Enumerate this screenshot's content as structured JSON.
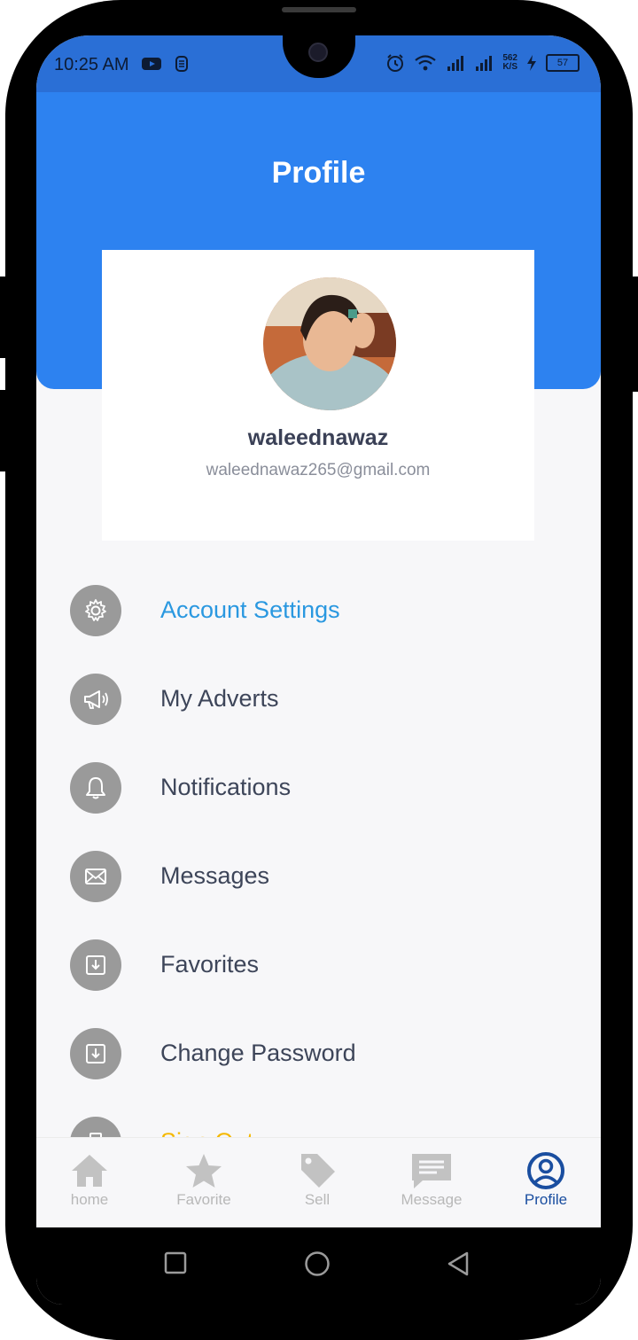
{
  "status_bar": {
    "time": "10:25 AM",
    "speed_top": "562",
    "speed_bottom": "K/S",
    "battery": "57",
    "icons": [
      "youtube-icon",
      "s-app-icon",
      "alarm-icon",
      "wifi-icon",
      "signal-icon",
      "signal-icon",
      "charging-icon",
      "battery-icon"
    ]
  },
  "header": {
    "title": "Profile"
  },
  "profile": {
    "name": "waleednawaz",
    "email": "waleednawaz265@gmail.com"
  },
  "menu": {
    "items": [
      {
        "label": "Account Settings",
        "icon": "gear-icon"
      },
      {
        "label": "My Adverts",
        "icon": "megaphone-icon"
      },
      {
        "label": "Notifications",
        "icon": "bell-icon"
      },
      {
        "label": "Messages",
        "icon": "envelope-icon"
      },
      {
        "label": "Favorites",
        "icon": "download-box-icon"
      },
      {
        "label": "Change Password",
        "icon": "download-box-icon"
      },
      {
        "label": "Sign Out",
        "icon": "signout-icon"
      }
    ]
  },
  "bottom_nav": {
    "items": [
      {
        "label": "home",
        "icon": "home-icon"
      },
      {
        "label": "Favorite",
        "icon": "star-icon"
      },
      {
        "label": "Sell",
        "icon": "tag-icon"
      },
      {
        "label": "Message",
        "icon": "message-icon"
      },
      {
        "label": "Profile",
        "icon": "user-circle-icon"
      }
    ],
    "active": "Profile"
  },
  "colors": {
    "header": "#2d82f0",
    "active_menu": "#2a98e0",
    "signout": "#f5b800",
    "active_nav": "#1a4ea0"
  }
}
